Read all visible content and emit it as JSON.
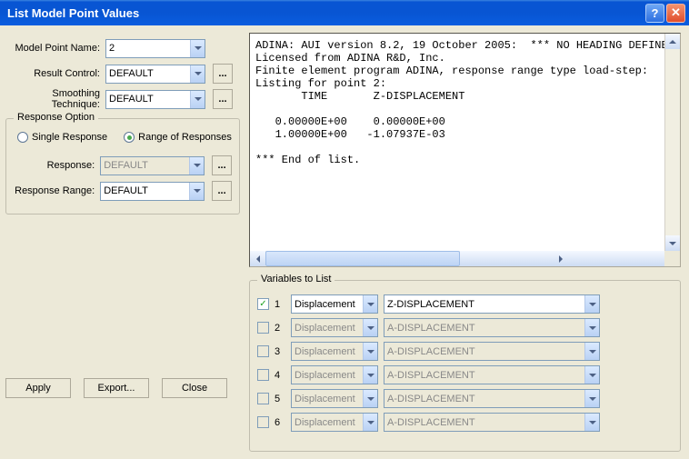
{
  "title": "List Model Point Values",
  "fields": {
    "model_point_name": {
      "label": "Model Point Name:",
      "value": "2"
    },
    "result_control": {
      "label": "Result Control:",
      "value": "DEFAULT"
    },
    "smoothing_technique": {
      "label": "Smoothing Technique:",
      "value": "DEFAULT"
    }
  },
  "response_option": {
    "legend": "Response Option",
    "single": "Single Response",
    "range": "Range of Responses",
    "response": {
      "label": "Response:",
      "value": "DEFAULT"
    },
    "response_range": {
      "label": "Response Range:",
      "value": "DEFAULT"
    }
  },
  "buttons": {
    "apply": "Apply",
    "export": "Export...",
    "close": "Close",
    "dots": "..."
  },
  "output_text": "ADINA: AUI version 8.2, 19 October 2005:  *** NO HEADING DEFINED\nLicensed from ADINA R&D, Inc.\nFinite element program ADINA, response range type load-step:\nListing for point 2:\n       TIME       Z-DISPLACEMENT\n\n   0.00000E+00    0.00000E+00\n   1.00000E+00   -1.07937E-03\n\n*** End of list.",
  "variables_to_list": {
    "legend": "Variables to List",
    "rows": [
      {
        "n": "1",
        "checked": true,
        "cat": "Displacement",
        "var": "Z-DISPLACEMENT"
      },
      {
        "n": "2",
        "checked": false,
        "cat": "Displacement",
        "var": "A-DISPLACEMENT"
      },
      {
        "n": "3",
        "checked": false,
        "cat": "Displacement",
        "var": "A-DISPLACEMENT"
      },
      {
        "n": "4",
        "checked": false,
        "cat": "Displacement",
        "var": "A-DISPLACEMENT"
      },
      {
        "n": "5",
        "checked": false,
        "cat": "Displacement",
        "var": "A-DISPLACEMENT"
      },
      {
        "n": "6",
        "checked": false,
        "cat": "Displacement",
        "var": "A-DISPLACEMENT"
      }
    ]
  }
}
